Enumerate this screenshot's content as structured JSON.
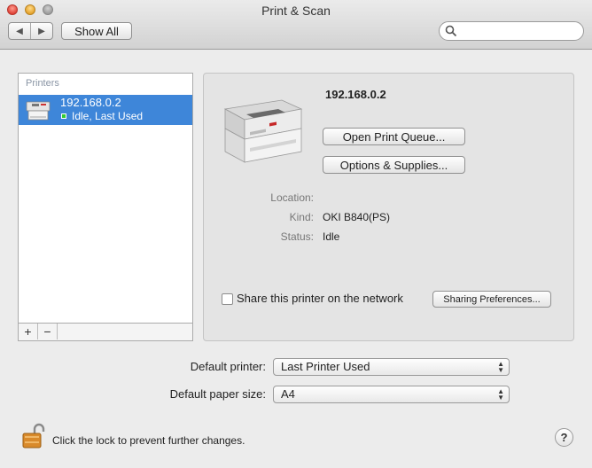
{
  "window": {
    "title": "Print & Scan"
  },
  "toolbar": {
    "back_glyph": "◀",
    "forward_glyph": "▶",
    "show_all_label": "Show All",
    "search_placeholder": "",
    "search_value": ""
  },
  "printers": {
    "header": "Printers",
    "items": [
      {
        "name": "192.168.0.2",
        "status": "Idle, Last Used",
        "status_color": "#33cc33"
      }
    ],
    "add_label": "+",
    "remove_label": "−"
  },
  "detail": {
    "printer_name": "192.168.0.2",
    "open_queue_label": "Open Print Queue...",
    "options_label": "Options & Supplies...",
    "fields": [
      {
        "key": "Location:",
        "value": ""
      },
      {
        "key": "Kind:",
        "value": "OKI B840(PS)"
      },
      {
        "key": "Status:",
        "value": "Idle"
      }
    ],
    "share_label": "Share this printer on the network",
    "share_checked": false,
    "sharing_prefs_label": "Sharing Preferences..."
  },
  "defaults": {
    "printer_label": "Default printer:",
    "printer_value": "Last Printer Used",
    "paper_label": "Default paper size:",
    "paper_value": "A4"
  },
  "footer": {
    "lock_text": "Click the lock to prevent further changes.",
    "help_label": "?"
  },
  "colors": {
    "selection": "#3e86d9",
    "accent_lock": "#d98a2b"
  }
}
